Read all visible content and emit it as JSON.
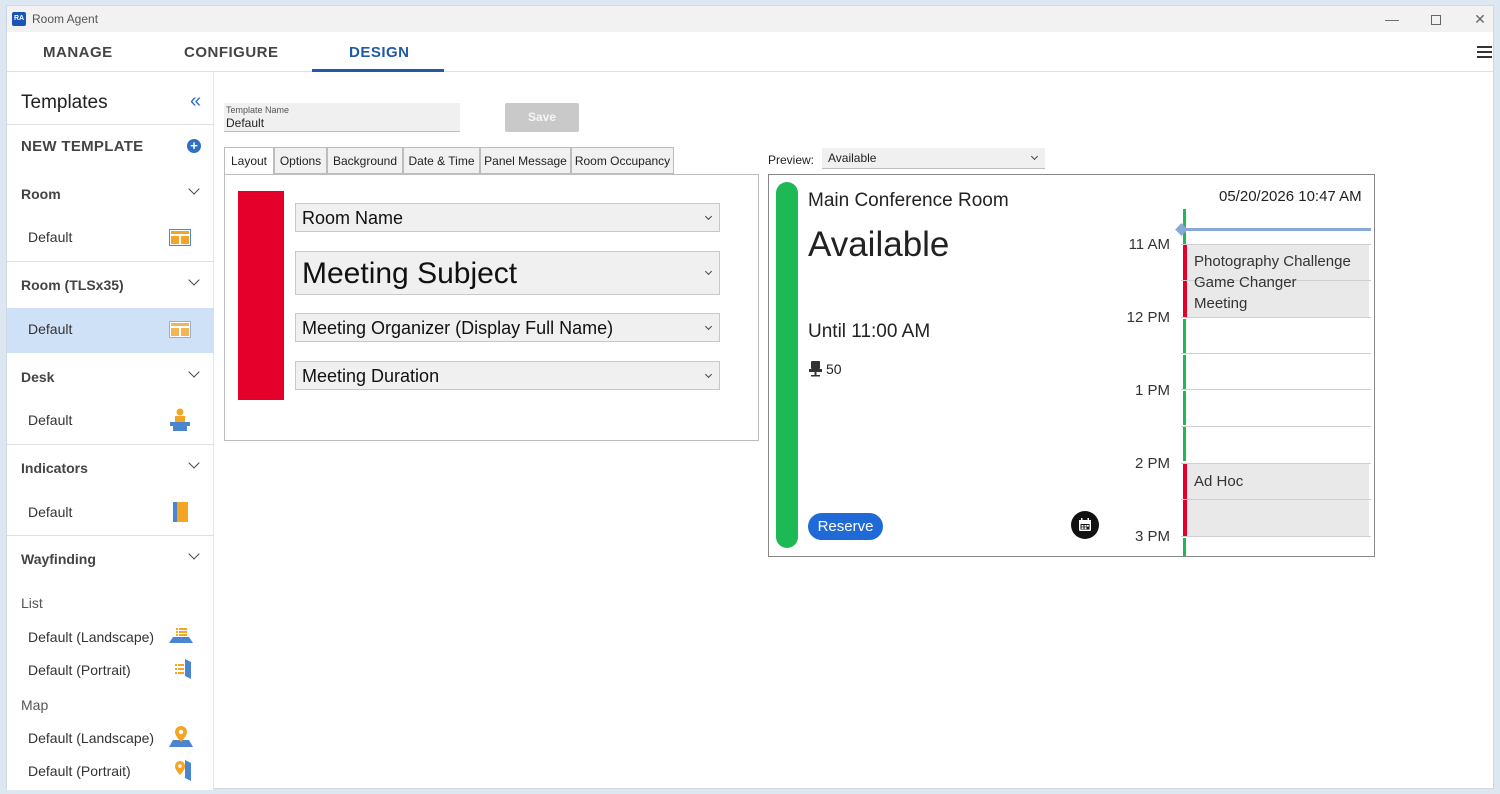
{
  "window": {
    "title": "Room Agent",
    "app_badge": "RA"
  },
  "nav": {
    "manage": "MANAGE",
    "configure": "CONFIGURE",
    "design": "DESIGN"
  },
  "sidebar": {
    "title": "Templates",
    "new_template": "NEW TEMPLATE",
    "groups": [
      {
        "label": "Room",
        "items": [
          "Default"
        ]
      },
      {
        "label": "Room (TLSx35)",
        "items": [
          "Default"
        ]
      },
      {
        "label": "Desk",
        "items": [
          "Default"
        ]
      },
      {
        "label": "Indicators",
        "items": [
          "Default"
        ]
      },
      {
        "label": "Wayfinding",
        "sub_list": "List",
        "list_items": [
          "Default (Landscape)",
          "Default (Portrait)"
        ],
        "sub_map": "Map",
        "map_items": [
          "Default (Landscape)",
          "Default (Portrait)"
        ]
      }
    ]
  },
  "template": {
    "name_label": "Template Name",
    "name_value": "Default",
    "save": "Save"
  },
  "tabs": [
    "Layout",
    "Options",
    "Background",
    "Date & Time",
    "Panel Message",
    "Room Occupancy"
  ],
  "layout": {
    "fields": [
      "Room Name",
      "Meeting Subject",
      "Meeting Organizer (Display Full Name)",
      "Meeting Duration"
    ]
  },
  "preview": {
    "label": "Preview:",
    "mode": "Available",
    "room": "Main Conference Room",
    "status": "Available",
    "until": "Until 11:00 AM",
    "seats": "50",
    "reserve": "Reserve",
    "datetime": "05/20/2026 10:47 AM",
    "times": [
      "11 AM",
      "12 PM",
      "1 PM",
      "2 PM",
      "3 PM"
    ],
    "events": [
      {
        "lines": [
          "Photography Challenge",
          "Game Changer",
          "Meeting"
        ]
      },
      {
        "lines": [
          "Ad Hoc"
        ]
      }
    ]
  },
  "colors": {
    "accent": "#1f5aa6",
    "status_available": "#1db954",
    "busy": "#e4002b",
    "selected": "#cfe1f7"
  }
}
